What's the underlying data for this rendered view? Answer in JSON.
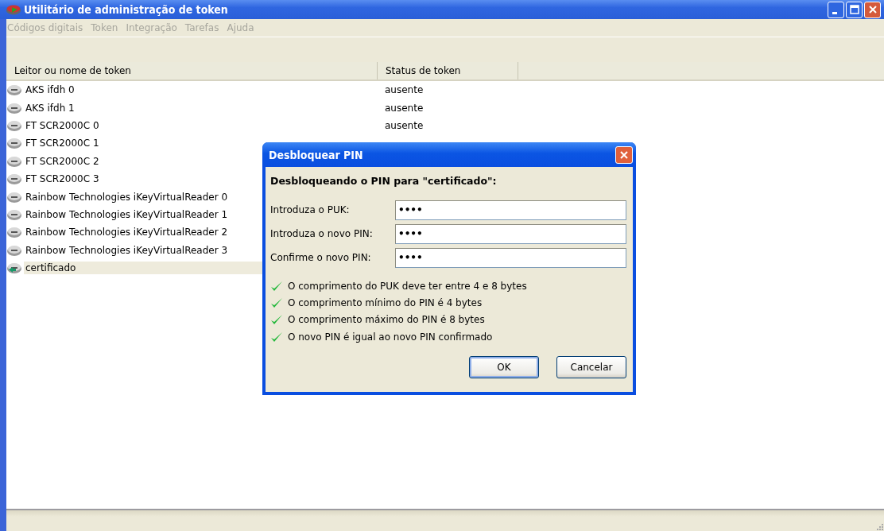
{
  "window": {
    "title": "Utilitário de administração de token"
  },
  "menu": [
    {
      "label": "Códigos digitais",
      "disabled": true
    },
    {
      "label": "Token",
      "disabled": true
    },
    {
      "label": "Integração",
      "disabled": true
    },
    {
      "label": "Tarefas",
      "disabled": true
    },
    {
      "label": "Ajuda",
      "disabled": true
    }
  ],
  "table": {
    "columns": [
      "Leitor ou nome de token",
      "Status de token"
    ],
    "rows": [
      {
        "kind": "reader",
        "name": "AKS ifdh 0",
        "status": "ausente",
        "selected": false
      },
      {
        "kind": "reader",
        "name": "AKS ifdh 1",
        "status": "ausente",
        "selected": false
      },
      {
        "kind": "reader",
        "name": "FT SCR2000C 0",
        "status": "ausente",
        "selected": false
      },
      {
        "kind": "reader",
        "name": "FT SCR2000C 1",
        "selected": false
      },
      {
        "kind": "reader",
        "name": "FT SCR2000C 2",
        "selected": false
      },
      {
        "kind": "reader",
        "name": "FT SCR2000C 3",
        "selected": false
      },
      {
        "kind": "reader",
        "name": "Rainbow Technologies iKeyVirtualReader 0",
        "selected": false
      },
      {
        "kind": "reader",
        "name": "Rainbow Technologies iKeyVirtualReader 1",
        "selected": false
      },
      {
        "kind": "reader",
        "name": "Rainbow Technologies iKeyVirtualReader 2",
        "selected": false
      },
      {
        "kind": "reader",
        "name": "Rainbow Technologies iKeyVirtualReader 3",
        "selected": false
      },
      {
        "kind": "token",
        "name": "certificado",
        "selected": true
      }
    ]
  },
  "dialog": {
    "title": "Desbloquear PIN",
    "heading": "Desbloqueando o PIN para \"certificado\":",
    "fields": [
      {
        "label": "Introduza o PUK:",
        "value": "••••"
      },
      {
        "label": "Introduza o novo PIN:",
        "value": "••••"
      },
      {
        "label": "Confirme o novo PIN:",
        "value": "••••"
      }
    ],
    "checks": [
      {
        "text": "O comprimento do PUK deve ter entre 4 e 8 bytes",
        "checked": true
      },
      {
        "text": "O comprimento mínimo do PIN é 4 bytes",
        "checked": true
      },
      {
        "text": "O comprimento máximo do PIN é 8 bytes",
        "checked": true
      },
      {
        "text": "O novo PIN é igual ao novo PIN confirmado",
        "checked": true
      }
    ],
    "buttons": [
      {
        "label": "OK",
        "default": true
      },
      {
        "label": "Cancelar",
        "default": false
      }
    ]
  }
}
